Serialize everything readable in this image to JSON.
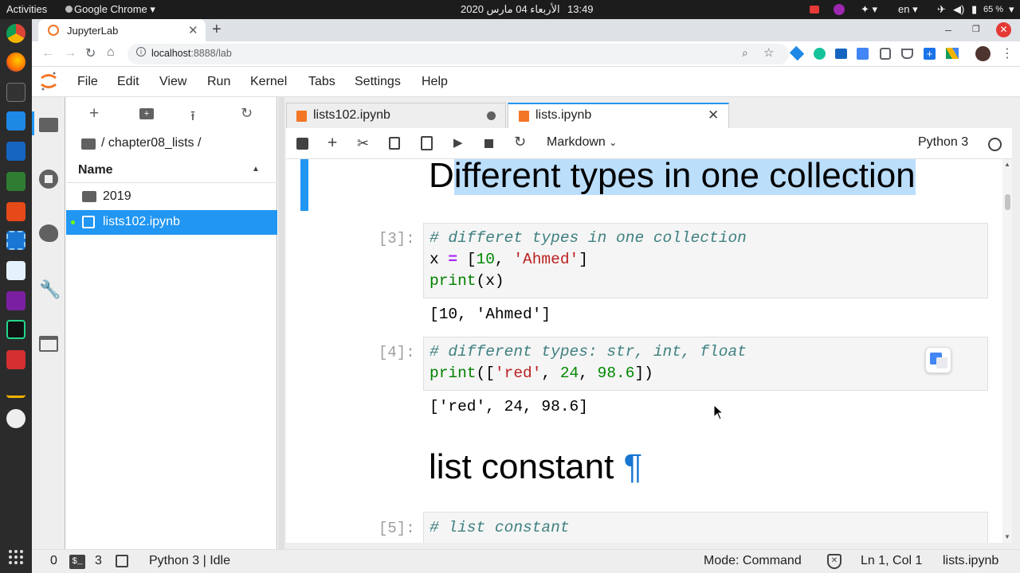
{
  "system_bar": {
    "activities": "Activities",
    "app_menu": "Google Chrome",
    "date": "الأربعاء 04 مارس 2020",
    "time": "13:49",
    "lang": "en",
    "battery": "65 %"
  },
  "browser": {
    "tab_title": "JupyterLab",
    "url_host": "localhost",
    "url_rest": ":8888/lab"
  },
  "menu": {
    "items": [
      "File",
      "Edit",
      "View",
      "Run",
      "Kernel",
      "Tabs",
      "Settings",
      "Help"
    ]
  },
  "file_browser": {
    "breadcrumb": "/ chapter08_lists /",
    "column_name": "Name",
    "items": [
      {
        "name": "2019",
        "type": "folder"
      },
      {
        "name": "lists102.ipynb",
        "type": "notebook",
        "selected": true
      }
    ]
  },
  "notebook_tabs": [
    {
      "title": "lists102.ipynb",
      "active": false,
      "dirty": true
    },
    {
      "title": "lists.ipynb",
      "active": true
    }
  ],
  "toolbar": {
    "cell_type": "Markdown",
    "kernel": "Python 3"
  },
  "cells": {
    "heading1": {
      "first": "D",
      "rest": "ifferent types in one collection"
    },
    "c3": {
      "prompt": "[3]:",
      "l1": "# differet types in one collection",
      "l2": {
        "a": "x ",
        "op": "=",
        "b": " [",
        "num": "10",
        "c": ", ",
        "str": "'Ahmed'",
        "d": "]"
      },
      "l3": {
        "fn": "print",
        "rest": "(x)"
      },
      "output": "[10, 'Ahmed']"
    },
    "c4": {
      "prompt": "[4]:",
      "l1": "# different types: str, int, float",
      "l2": {
        "fn": "print",
        "a": "([",
        "s": "'red'",
        "b": ", ",
        "n1": "24",
        "c": ", ",
        "n2": "98.6",
        "d": "])"
      },
      "output": "['red', 24, 98.6]"
    },
    "heading2": {
      "text": "list constant ",
      "anchor": "¶"
    },
    "c5": {
      "prompt": "[5]:",
      "l1": "# list constant"
    }
  },
  "status_bar": {
    "count1": "0",
    "count2": "3",
    "kernel_status": "Python 3 | Idle",
    "mode": "Mode: Command",
    "position": "Ln 1, Col 1",
    "filename": "lists.ipynb"
  },
  "colors": {
    "accent": "#2196f3",
    "jupyter_orange": "#f37626",
    "selection": "#bbdefb"
  }
}
